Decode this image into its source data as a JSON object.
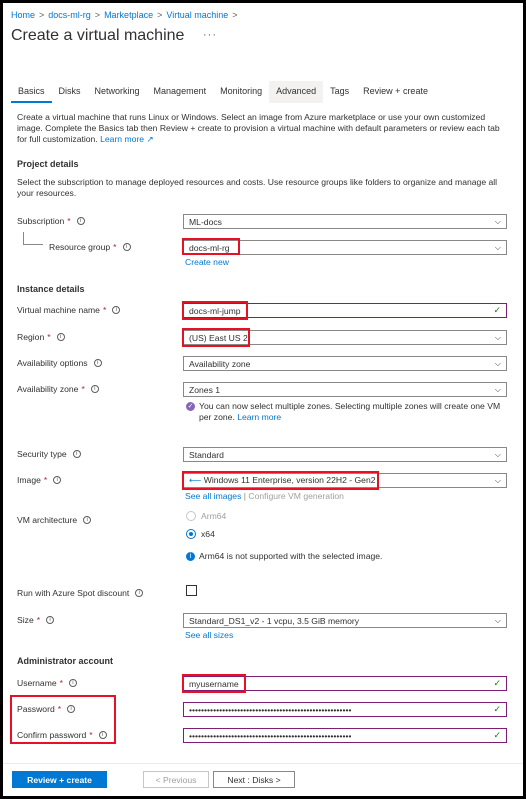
{
  "breadcrumb": [
    "Home",
    "docs-ml-rg",
    "Marketplace",
    "Virtual machine"
  ],
  "page_title": "Create a virtual machine",
  "more_label": "···",
  "tabs": [
    "Basics",
    "Disks",
    "Networking",
    "Management",
    "Monitoring",
    "Advanced",
    "Tags",
    "Review + create"
  ],
  "intro": {
    "text": "Create a virtual machine that runs Linux or Windows. Select an image from Azure marketplace or use your own customized image. Complete the Basics tab then Review + create to provision a virtual machine with default parameters or review each tab for full customization.",
    "learn_more": "Learn more"
  },
  "project": {
    "heading": "Project details",
    "desc": "Select the subscription to manage deployed resources and costs. Use resource groups like folders to organize and manage all your resources.",
    "subscription_label": "Subscription",
    "subscription_value": "ML-docs",
    "rg_label": "Resource group",
    "rg_value": "docs-ml-rg",
    "create_new": "Create new"
  },
  "instance": {
    "heading": "Instance details",
    "vmname_label": "Virtual machine name",
    "vmname_value": "docs-ml-jump",
    "region_label": "Region",
    "region_value": "(US) East US 2",
    "avail_opt_label": "Availability options",
    "avail_opt_value": "Availability zone",
    "avail_zone_label": "Availability zone",
    "avail_zone_value": "Zones 1",
    "zones_note": "You can now select multiple zones. Selecting multiple zones will create one VM per zone.",
    "zones_learn_more": "Learn more",
    "security_label": "Security type",
    "security_value": "Standard",
    "image_label": "Image",
    "image_value": "Windows 11 Enterprise, version 22H2 - Gen2",
    "see_all_images": "See all images",
    "configure_gen": "Configure VM generation",
    "arch_label": "VM architecture",
    "arch_options": [
      "Arm64",
      "x64"
    ],
    "arch_note": "Arm64 is not supported with the selected image.",
    "spot_label": "Run with Azure Spot discount",
    "size_label": "Size",
    "size_value": "Standard_DS1_v2 - 1 vcpu, 3.5 GiB memory",
    "see_all_sizes": "See all sizes"
  },
  "admin": {
    "heading": "Administrator account",
    "username_label": "Username",
    "username_value": "myusername",
    "password_label": "Password",
    "password_value": "••••••••••••••••••••••••••••••••••••••••••••••••••••••",
    "confirm_label": "Confirm password",
    "confirm_value": "••••••••••••••••••••••••••••••••••••••••••••••••••••••"
  },
  "footer": {
    "review_create": "Review + create",
    "previous": "< Previous",
    "next": "Next : Disks >"
  },
  "symbols": {
    "required": "*",
    "info": "i",
    "chevron": "⌵",
    "check": "✓",
    "sep": ">",
    "external": "↗",
    "note_check": "✓",
    "note_info": "i",
    "image_icon": "⟵"
  },
  "colors": {
    "accent": "#0078d4",
    "highlight": "#e81123",
    "valid": "#107c10",
    "focus_border": "#7a1f73"
  }
}
